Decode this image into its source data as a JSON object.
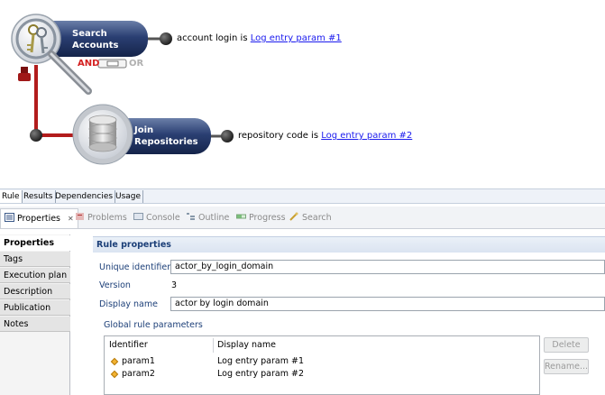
{
  "diagram": {
    "node_search": {
      "line1": "Search",
      "line2": "Accounts",
      "icon": "keys-magnifier-icon"
    },
    "node_join": {
      "line1": "Join",
      "line2": "Repositories",
      "icon": "gear-database-icon"
    },
    "condition1": {
      "prefix": "account login is",
      "link": "Log entry param #1"
    },
    "condition2": {
      "prefix": "repository code is",
      "link": "Log entry param #2"
    },
    "logic": {
      "and_label": "AND",
      "or_label": "OR"
    },
    "colors": {
      "node_fill": "#1e3160",
      "connector": "#b21c1c",
      "and_color": "#d42020",
      "or_color": "#b0b0b0"
    }
  },
  "editor_tabs": [
    "Rule",
    "Results",
    "Dependencies",
    "Usage"
  ],
  "views": {
    "active": {
      "label": "Properties",
      "icon": "properties-icon",
      "close_icon": "close-icon",
      "close_glyph": "✕"
    },
    "others": [
      {
        "label": "Problems",
        "icon": "problems-icon"
      },
      {
        "label": "Console",
        "icon": "console-icon"
      },
      {
        "label": "Outline",
        "icon": "outline-icon"
      },
      {
        "label": "Progress",
        "icon": "progress-icon"
      },
      {
        "label": "Search",
        "icon": "search-icon"
      }
    ]
  },
  "sections": [
    "Properties",
    "Tags",
    "Execution plan",
    "Description",
    "Publication",
    "Notes"
  ],
  "rule_properties": {
    "header": "Rule properties",
    "unique_identifier_label": "Unique identifier",
    "unique_identifier_value": "actor_by_login_domain",
    "version_label": "Version",
    "version_value": "3",
    "display_name_label": "Display name",
    "display_name_value": "actor by login domain"
  },
  "params": {
    "title": "Global rule parameters",
    "columns": [
      "Identifier",
      "Display name"
    ],
    "rows": [
      {
        "id": "param1",
        "name": "Log entry param #1"
      },
      {
        "id": "param2",
        "name": "Log entry param #2"
      }
    ],
    "delete_label": "Delete",
    "rename_label": "Rename..."
  }
}
